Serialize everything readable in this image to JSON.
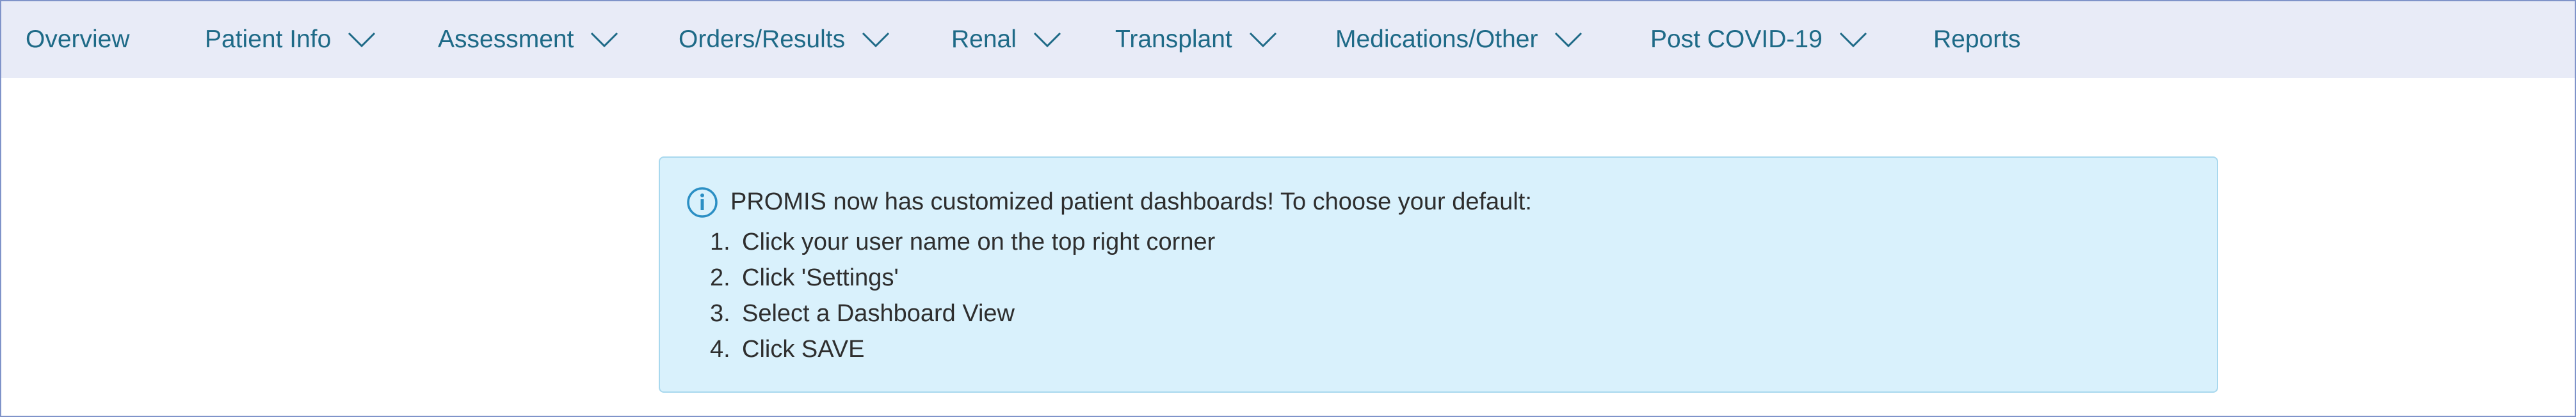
{
  "nav": {
    "items": [
      {
        "label": "Overview",
        "has_dropdown": false
      },
      {
        "label": "Patient Info",
        "has_dropdown": true
      },
      {
        "label": "Assessment",
        "has_dropdown": true
      },
      {
        "label": "Orders/Results",
        "has_dropdown": true
      },
      {
        "label": "Renal",
        "has_dropdown": true
      },
      {
        "label": "Transplant",
        "has_dropdown": true
      },
      {
        "label": "Medications/Other",
        "has_dropdown": true
      },
      {
        "label": "Post COVID-19",
        "has_dropdown": true
      },
      {
        "label": "Reports",
        "has_dropdown": false
      }
    ],
    "dropdown_icon": "chevron-down-icon"
  },
  "notice": {
    "icon": "info-icon",
    "title": "PROMIS now has customized patient dashboards! To choose your default:",
    "steps": [
      {
        "num": "1.",
        "text": "Click your user name on the top right corner"
      },
      {
        "num": "2.",
        "text": "Click 'Settings'"
      },
      {
        "num": "3.",
        "text": "Select a Dashboard View"
      },
      {
        "num": "4.",
        "text": "Click SAVE"
      }
    ]
  },
  "colors": {
    "nav_background": "#e8ebf7",
    "nav_text": "#1e6a87",
    "notice_background": "#d9f1fc",
    "notice_border": "#a8d8ee",
    "info_icon": "#2b8fc4",
    "frame_border": "#7f93c9"
  }
}
